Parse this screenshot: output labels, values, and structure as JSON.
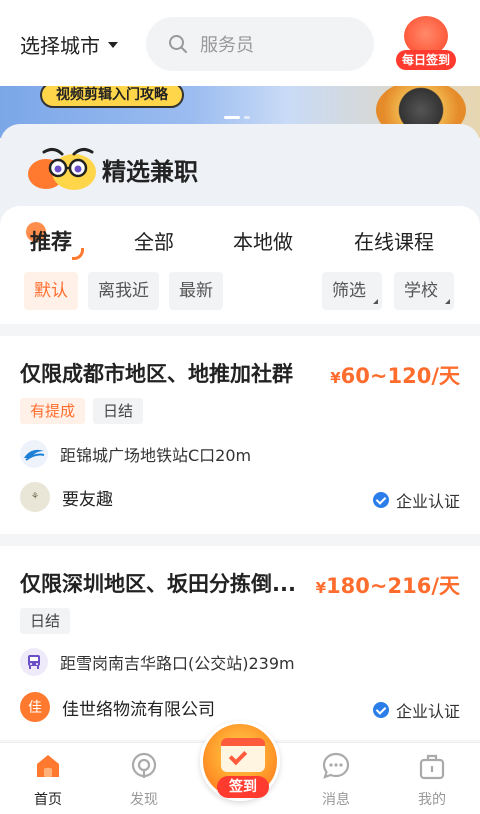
{
  "topbar": {
    "city_label": "选择城市",
    "search_placeholder": "服务员",
    "daily_signin_label": "每日签到"
  },
  "banner": {
    "button_text": "视频剪辑入门攻略"
  },
  "featured": {
    "title": "精选兼职"
  },
  "tabs": [
    {
      "label": "推荐",
      "active": true
    },
    {
      "label": "全部",
      "active": false
    },
    {
      "label": "本地做",
      "active": false
    },
    {
      "label": "在线课程",
      "active": false
    }
  ],
  "chips": {
    "sort": [
      {
        "label": "默认",
        "active": true
      },
      {
        "label": "离我近",
        "active": false
      },
      {
        "label": "最新",
        "active": false
      }
    ],
    "filters": [
      {
        "label": "筛选"
      },
      {
        "label": "学校"
      }
    ]
  },
  "jobs": [
    {
      "title": "仅限成都市地区、地推加社群",
      "salary_currency": "¥",
      "salary": "60~120/天",
      "tags": [
        {
          "label": "有提成",
          "style": "orange"
        },
        {
          "label": "日结",
          "style": "gray"
        }
      ],
      "location": "距锦城广场地铁站C口20m",
      "location_icon": "metro-icon",
      "company": "要友趣",
      "verified_label": "企业认证"
    },
    {
      "title": "仅限深圳地区、坂田分拣倒...",
      "salary_currency": "¥",
      "salary": "180~216/天",
      "tags": [
        {
          "label": "日结",
          "style": "gray"
        }
      ],
      "location": "距雪岗南吉华路口(公交站)239m",
      "location_icon": "bus-icon",
      "company": "佳世络物流有限公司",
      "company_initial": "佳",
      "verified_label": "企业认证"
    }
  ],
  "nav": {
    "items": [
      {
        "label": "首页",
        "icon": "home-icon",
        "active": true
      },
      {
        "label": "发现",
        "icon": "discover-icon",
        "active": false
      },
      {
        "label": "消息",
        "icon": "message-icon",
        "active": false
      },
      {
        "label": "我的",
        "icon": "profile-icon",
        "active": false
      }
    ],
    "center_label": "签到"
  },
  "colors": {
    "accent": "#ff6d2e",
    "verify_blue": "#2b7de9"
  }
}
